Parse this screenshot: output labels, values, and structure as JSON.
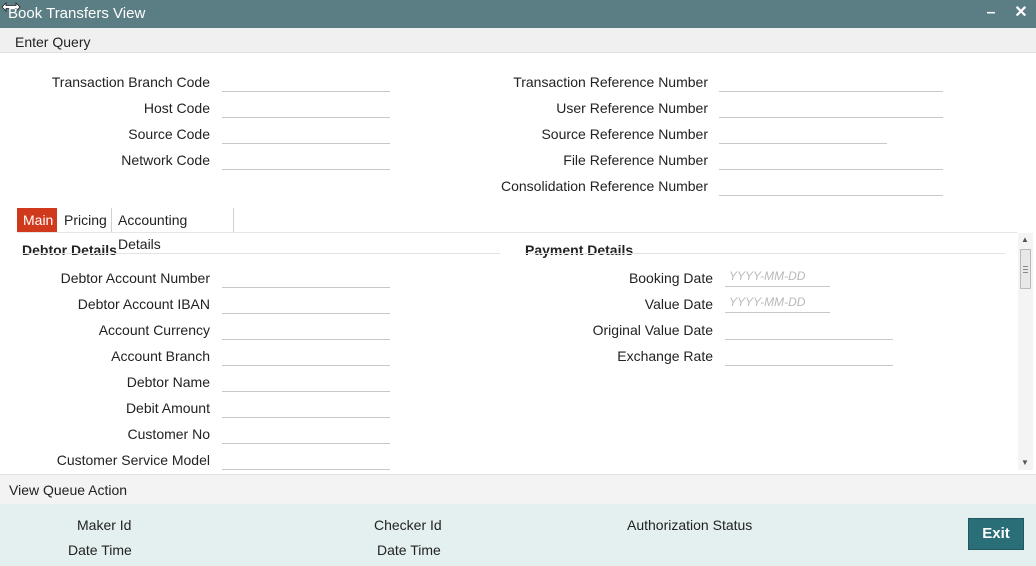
{
  "window": {
    "title": "Book Transfers View",
    "minimize_icon": "minimize-icon",
    "close_icon": "close-icon"
  },
  "menu": {
    "enter_query": "Enter Query"
  },
  "header_fields": {
    "left": [
      {
        "label": "Transaction Branch Code",
        "value": ""
      },
      {
        "label": "Host Code",
        "value": ""
      },
      {
        "label": "Source Code",
        "value": ""
      },
      {
        "label": "Network Code",
        "value": ""
      }
    ],
    "right": [
      {
        "label": "Transaction Reference Number",
        "value": ""
      },
      {
        "label": "User Reference Number",
        "value": ""
      },
      {
        "label": "Source Reference Number",
        "value": ""
      },
      {
        "label": "File Reference Number",
        "value": ""
      },
      {
        "label": "Consolidation Reference Number",
        "value": ""
      }
    ]
  },
  "tabs": [
    {
      "label": "Main",
      "active": true
    },
    {
      "label": "Pricing",
      "active": false
    },
    {
      "label": "Accounting Details",
      "active": false
    }
  ],
  "debtor": {
    "title": "Debtor Details",
    "fields": [
      {
        "label": "Debtor Account Number",
        "value": ""
      },
      {
        "label": "Debtor Account IBAN",
        "value": ""
      },
      {
        "label": "Account Currency",
        "value": ""
      },
      {
        "label": "Account Branch",
        "value": ""
      },
      {
        "label": "Debtor Name",
        "value": ""
      },
      {
        "label": "Debit Amount",
        "value": ""
      },
      {
        "label": "Customer No",
        "value": ""
      },
      {
        "label": "Customer Service Model",
        "value": ""
      }
    ]
  },
  "payment": {
    "title": "Payment Details",
    "fields": [
      {
        "label": "Booking Date",
        "value": "",
        "placeholder": "YYYY-MM-DD"
      },
      {
        "label": "Value Date",
        "value": "",
        "placeholder": "YYYY-MM-DD"
      },
      {
        "label": "Original Value Date",
        "value": "",
        "placeholder": ""
      },
      {
        "label": "Exchange Rate",
        "value": "",
        "placeholder": ""
      }
    ]
  },
  "queue": {
    "view_queue_action": "View Queue Action"
  },
  "footer": {
    "maker_id": "Maker Id",
    "date_time_1": "Date Time",
    "checker_id": "Checker Id",
    "date_time_2": "Date Time",
    "authorization_status": "Authorization Status",
    "exit_label": "Exit"
  },
  "colors": {
    "titlebar": "#5b7e85",
    "active_tab": "#d0391b",
    "footer_bg": "#e4f0ef",
    "exit_button": "#2a6f78"
  }
}
